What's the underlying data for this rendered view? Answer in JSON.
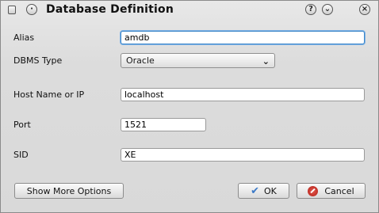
{
  "window": {
    "title": "Database Definition",
    "help_icon": "question-icon",
    "menu_icon": "chevron-down-icon",
    "close_icon": "close-icon"
  },
  "form": {
    "alias": {
      "label": "Alias",
      "value": "amdb"
    },
    "dbms_type": {
      "label": "DBMS Type",
      "value": "Oracle"
    },
    "host": {
      "label": "Host Name or IP",
      "value": "localhost"
    },
    "port": {
      "label": "Port",
      "value": "1521"
    },
    "sid": {
      "label": "SID",
      "value": "XE"
    }
  },
  "buttons": {
    "more_options": "Show More Options",
    "ok": "OK",
    "cancel": "Cancel"
  },
  "colors": {
    "focus": "#3d87c9",
    "cancel_icon": "#c9271e",
    "ok_icon": "#3b79c7"
  }
}
